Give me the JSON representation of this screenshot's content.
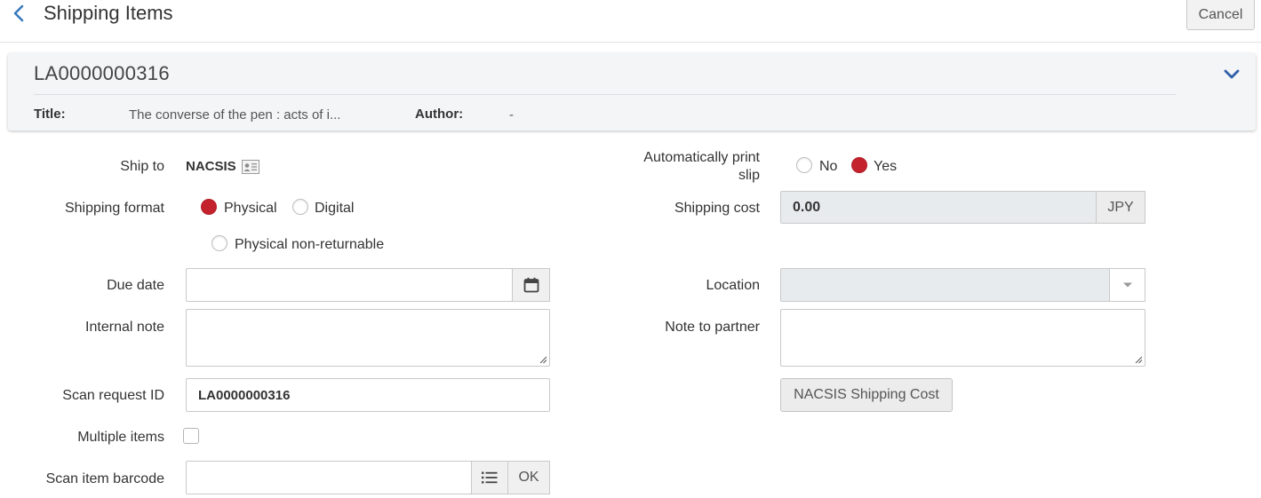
{
  "header": {
    "title": "Shipping Items",
    "cancel_label": "Cancel"
  },
  "summary": {
    "id": "LA0000000316",
    "title_label": "Title:",
    "title_value": "The converse of the pen : acts of i...",
    "author_label": "Author:",
    "author_value": "-"
  },
  "form": {
    "ship_to": {
      "label": "Ship to",
      "value": "NACSIS",
      "icon": "contact-card-icon"
    },
    "auto_print": {
      "label_line1": "Automatically print",
      "label_line2": "slip",
      "options": [
        "No",
        "Yes"
      ],
      "selected": "Yes"
    },
    "shipping_format": {
      "label": "Shipping format",
      "options": [
        "Physical",
        "Digital",
        "Physical non-returnable"
      ],
      "selected": "Physical"
    },
    "shipping_cost": {
      "label": "Shipping cost",
      "value": "0.00",
      "currency": "JPY"
    },
    "due_date": {
      "label": "Due date",
      "value": "",
      "icon": "calendar-icon"
    },
    "location": {
      "label": "Location",
      "value": "",
      "icon": "caret-down-icon"
    },
    "internal_note": {
      "label": "Internal note",
      "value": ""
    },
    "note_to_partner": {
      "label": "Note to partner",
      "value": ""
    },
    "scan_request_id": {
      "label": "Scan request ID",
      "value": "LA0000000316"
    },
    "nacsis_button": {
      "label": "NACSIS Shipping Cost"
    },
    "multiple_items": {
      "label": "Multiple items",
      "checked": false
    },
    "scan_item_barcode": {
      "label": "Scan item barcode",
      "value": "",
      "list_icon": "list-icon",
      "ok_label": "OK"
    }
  },
  "colors": {
    "accent": "#c4232d",
    "link": "#3a7abf",
    "card_bg": "#f3f5f7",
    "disabled_bg": "#e8ebee"
  }
}
